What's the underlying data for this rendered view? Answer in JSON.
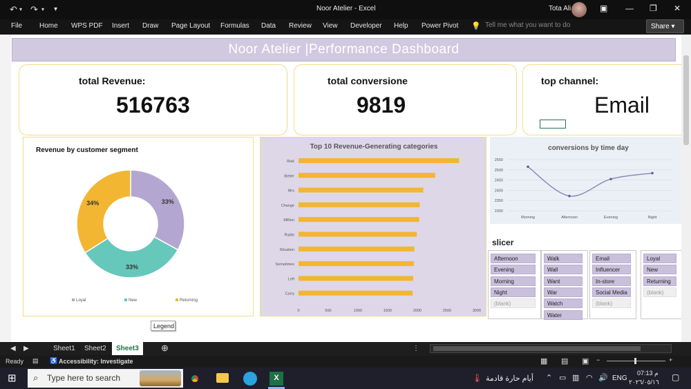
{
  "window": {
    "title": "Noor Atelier  -  Excel",
    "user": "Tota Ali"
  },
  "ribbon": {
    "tabs": [
      "File",
      "Home",
      "WPS PDF",
      "Insert",
      "Draw",
      "Page Layout",
      "Formulas",
      "Data",
      "Review",
      "View",
      "Developer",
      "Help",
      "Power Pivot"
    ],
    "tell_me": "Tell me what you want to do",
    "share": "Share"
  },
  "dashboard": {
    "banner": "Noor Atelier |Performance Dashboard",
    "kpis": [
      {
        "label": "total Revenue:",
        "value": "516763"
      },
      {
        "label": "total conversione",
        "value": "9819"
      },
      {
        "label": "top channel:",
        "value": "Email"
      }
    ],
    "slicer_label": "slicer",
    "legend_tooltip": "Legend"
  },
  "charts": {
    "donut": {
      "title": "Revenue by customer segment"
    },
    "bar": {
      "title": "Top 10 Revenue-Generating categories"
    },
    "line": {
      "title": "conversions by time day"
    }
  },
  "chart_data": [
    {
      "type": "pie",
      "title": "Revenue by customer segment",
      "labels": [
        "Loyal",
        "New",
        "Returning"
      ],
      "values": [
        33,
        33,
        34
      ],
      "value_labels": [
        "33%",
        "33%",
        "34%"
      ],
      "colors": [
        "#b3a7d1",
        "#66c8ba",
        "#f2b632"
      ],
      "legend": "bottom"
    },
    {
      "type": "bar",
      "orientation": "horizontal",
      "title": "Top 10 Revenue-Generating categories",
      "categories": [
        "Risk",
        "Better",
        "Mrs",
        "Change",
        "Million",
        "Radio",
        "Situation",
        "Sometimes",
        "Left",
        "Carry"
      ],
      "values": [
        2700,
        2300,
        2100,
        2040,
        2030,
        1990,
        1950,
        1940,
        1930,
        1920
      ],
      "xticks": [
        0,
        500,
        1000,
        1500,
        2000,
        2500,
        3000
      ],
      "xlim": [
        0,
        3000
      ],
      "color": "#f2b632"
    },
    {
      "type": "line",
      "title": "conversions by time day",
      "categories": [
        "Morning",
        "Afternoon",
        "Evening",
        "Night"
      ],
      "values": [
        2515,
        2372,
        2455,
        2484
      ],
      "yticks": [
        2300,
        2350,
        2400,
        2450,
        2500,
        2550
      ],
      "ylim": [
        2300,
        2550
      ],
      "color": "#8a82b5",
      "smooth": true
    }
  ],
  "slicers": [
    {
      "items": [
        "Afternoon",
        "Evening",
        "Morning",
        "Night",
        "(blank)"
      ]
    },
    {
      "items": [
        "Walk",
        "Wall",
        "Want",
        "War",
        "Watch",
        "Water"
      ]
    },
    {
      "items": [
        "Email",
        "Influencer",
        "In-store",
        "Social Media",
        "(blank)"
      ]
    },
    {
      "items": [
        "Loyal",
        "New",
        "Returning",
        "(blank)"
      ]
    }
  ],
  "sheets": {
    "tabs": [
      "Sheet1",
      "Sheet2",
      "Sheet3"
    ],
    "active": "Sheet3"
  },
  "status": {
    "ready": "Ready",
    "accessibility": "Accessibility: Investigate"
  },
  "taskbar": {
    "search_placeholder": "Type here to search",
    "weather": "أيام حارة قادمة",
    "lang": "ENG",
    "time": "07:13 م",
    "date": "٢٠٢٦/٠٥/١٦"
  }
}
